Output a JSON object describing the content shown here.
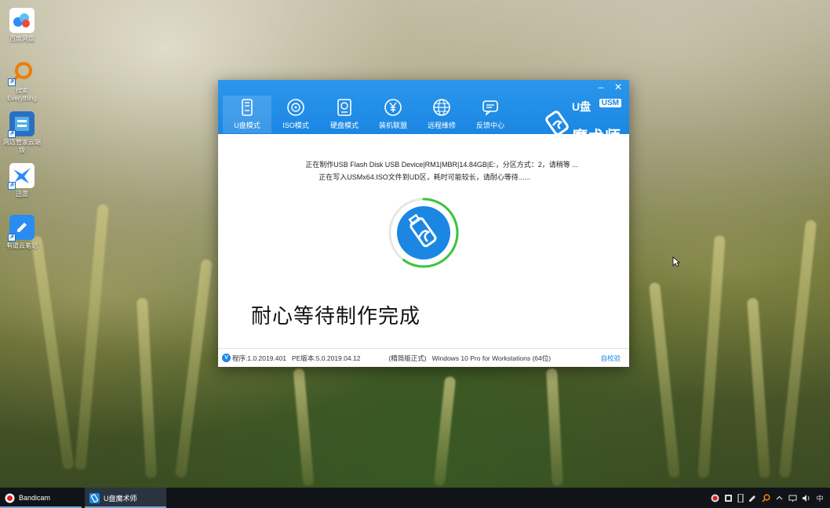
{
  "desktop": {
    "icons": [
      {
        "label": "百度网盘",
        "icon": "baidu-netdisk-icon"
      },
      {
        "label": "搜索 Everything",
        "icon": "everything-search-icon"
      },
      {
        "label": "网店管家云端版",
        "icon": "wangdian-guanjia-icon"
      },
      {
        "label": "迅雷",
        "icon": "xunlei-icon"
      },
      {
        "label": "有道云笔记",
        "icon": "youdao-note-icon"
      }
    ]
  },
  "window": {
    "minimize_glyph": "–",
    "close_glyph": "✕",
    "tabs": [
      {
        "label": "U盘模式",
        "icon": "usb-drive-icon",
        "active": true
      },
      {
        "label": "ISO模式",
        "icon": "disc-icon",
        "active": false
      },
      {
        "label": "硬盘模式",
        "icon": "hard-disk-icon",
        "active": false
      },
      {
        "label": "装机联盟",
        "icon": "yen-coin-icon",
        "active": false
      },
      {
        "label": "远程维修",
        "icon": "globe-icon",
        "active": false
      },
      {
        "label": "反馈中心",
        "icon": "chat-icon",
        "active": false
      }
    ],
    "brand": {
      "u": "U盘",
      "usm": "USM",
      "name": "魔术师"
    },
    "status_line1": "正在制作USB Flash Disk USB Device|RM1|MBR|14.84GB|E:，分区方式：2，请稍等 ...",
    "status_line2": "正在写入USMx64.ISO文件到UD区，耗时可能较长，请耐心等待......",
    "progress_fraction": 0.6,
    "big_message": "耐心等待制作完成",
    "statusbar": {
      "version_badge": "V",
      "program_version": "程序:1.0.2019.401",
      "pe_version": "PE版本:5.0.2019.04.12",
      "edition": "(精简版正式)",
      "os": "Windows 10 Pro for Workstations (64位)",
      "self_check": "自校验"
    },
    "accent_color": "#1b87e3",
    "progress_color": "#3cc43c"
  },
  "taskbar": {
    "tasks": [
      {
        "label": "Bandicam",
        "icon": "bandicam-icon"
      },
      {
        "label": "U盘魔术师",
        "icon": "usm-app-icon"
      }
    ],
    "tray": {
      "ime": "中"
    }
  }
}
